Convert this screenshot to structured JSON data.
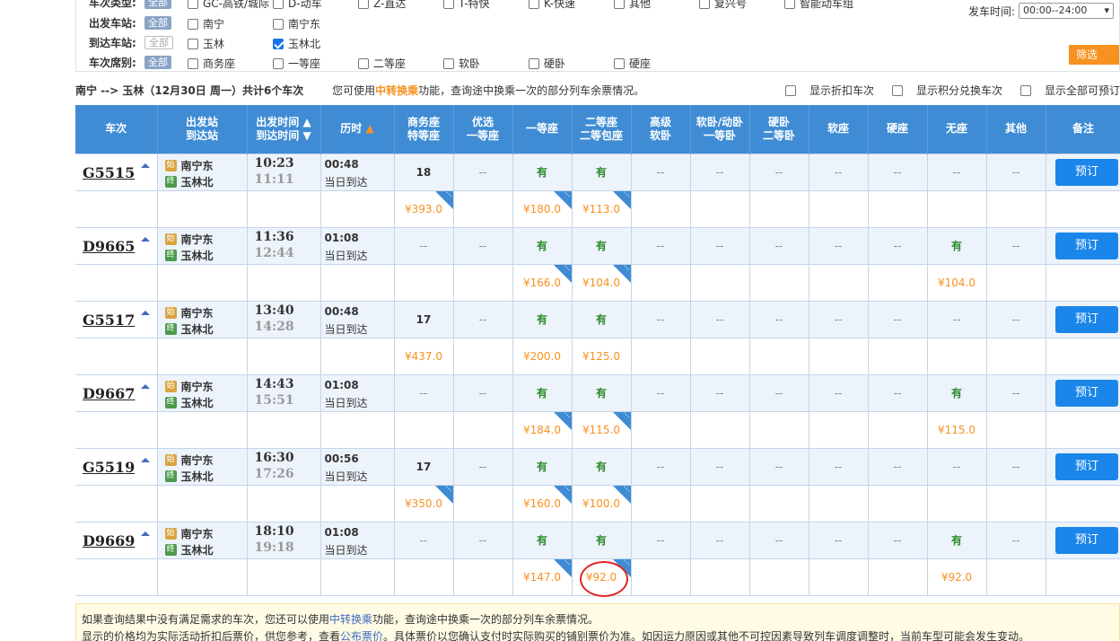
{
  "filters": {
    "type_row": {
      "label": "车次类型:",
      "all": "全部",
      "options": [
        "GC-高铁/城际",
        "D-动车",
        "Z-直达",
        "T-特快",
        "K-快速",
        "其他",
        "复兴号",
        "智能动车组"
      ]
    },
    "from_row": {
      "label": "出发车站:",
      "all": "全部",
      "options": [
        "南宁",
        "南宁东"
      ]
    },
    "to_row": {
      "label": "到达车站:",
      "all": "全部",
      "options": [
        "玉林",
        "玉林北"
      ]
    },
    "seat_row": {
      "label": "车次席别:",
      "all": "全部",
      "options": [
        "商务座",
        "一等座",
        "二等座",
        "软卧",
        "硬卧",
        "硬座"
      ]
    },
    "time_label": "发车时间:",
    "time_value": "00:00--24:00",
    "filter_button": "筛选"
  },
  "info": {
    "route": "南宁 --> 玉林（12月30日 周一）共计6个车次",
    "tip_prefix": "您可使用",
    "tip_link": "中转换乘",
    "tip_suffix": "功能，查询途中换乘一次的部分列车余票情况。",
    "check1": "显示折扣车次",
    "check2": "显示积分兑换车次",
    "check3": "显示全部可预订"
  },
  "headers": {
    "train": "车次",
    "station1": "出发站",
    "station2": "到达站",
    "time1": "出发时间",
    "time2": "到达时间",
    "duration": "历时",
    "business1": "商务座",
    "business2": "特等座",
    "premium1": "优选",
    "premium2": "一等座",
    "first": "一等座",
    "second1": "二等座",
    "second2": "二等包座",
    "hsoft1": "高级",
    "hsoft2": "软卧",
    "soft1": "软卧/动卧",
    "soft2": "一等卧",
    "hard1": "硬卧",
    "hard2": "二等卧",
    "softseat": "软座",
    "hardseat": "硬座",
    "noseat": "无座",
    "other": "其他",
    "remark": "备注"
  },
  "icons": {
    "start": "始",
    "end": "终"
  },
  "book_label": "预订",
  "trains": [
    {
      "no": "G5515",
      "from": "南宁东",
      "to": "玉林北",
      "dep": "10:23",
      "arr": "11:11",
      "dur": "00:48",
      "arrive": "当日到达",
      "business": "18",
      "premium": "--",
      "first": "有",
      "second": "有",
      "hsoft": "--",
      "soft": "--",
      "hard": "--",
      "softseat": "--",
      "hardseat": "--",
      "noseat": "--",
      "other": "--",
      "p_business": "¥393.0",
      "p_first": "¥180.0",
      "p_second": "¥113.0",
      "p_noseat": ""
    },
    {
      "no": "D9665",
      "from": "南宁东",
      "to": "玉林北",
      "dep": "11:36",
      "arr": "12:44",
      "dur": "01:08",
      "arrive": "当日到达",
      "business": "--",
      "premium": "--",
      "first": "有",
      "second": "有",
      "hsoft": "--",
      "soft": "--",
      "hard": "--",
      "softseat": "--",
      "hardseat": "--",
      "noseat": "有",
      "other": "--",
      "p_business": "",
      "p_first": "¥166.0",
      "p_second": "¥104.0",
      "p_noseat": "¥104.0"
    },
    {
      "no": "G5517",
      "from": "南宁东",
      "to": "玉林北",
      "dep": "13:40",
      "arr": "14:28",
      "dur": "00:48",
      "arrive": "当日到达",
      "business": "17",
      "premium": "--",
      "first": "有",
      "second": "有",
      "hsoft": "--",
      "soft": "--",
      "hard": "--",
      "softseat": "--",
      "hardseat": "--",
      "noseat": "--",
      "other": "--",
      "p_business": "¥437.0",
      "p_first": "¥200.0",
      "p_second": "¥125.0",
      "p_noseat": ""
    },
    {
      "no": "D9667",
      "from": "南宁东",
      "to": "玉林北",
      "dep": "14:43",
      "arr": "15:51",
      "dur": "01:08",
      "arrive": "当日到达",
      "business": "--",
      "premium": "--",
      "first": "有",
      "second": "有",
      "hsoft": "--",
      "soft": "--",
      "hard": "--",
      "softseat": "--",
      "hardseat": "--",
      "noseat": "有",
      "other": "--",
      "p_business": "",
      "p_first": "¥184.0",
      "p_second": "¥115.0",
      "p_noseat": "¥115.0"
    },
    {
      "no": "G5519",
      "from": "南宁东",
      "to": "玉林北",
      "dep": "16:30",
      "arr": "17:26",
      "dur": "00:56",
      "arrive": "当日到达",
      "business": "17",
      "premium": "--",
      "first": "有",
      "second": "有",
      "hsoft": "--",
      "soft": "--",
      "hard": "--",
      "softseat": "--",
      "hardseat": "--",
      "noseat": "--",
      "other": "--",
      "p_business": "¥350.0",
      "p_first": "¥160.0",
      "p_second": "¥100.0",
      "p_noseat": ""
    },
    {
      "no": "D9669",
      "from": "南宁东",
      "to": "玉林北",
      "dep": "18:10",
      "arr": "19:18",
      "dur": "01:08",
      "arrive": "当日到达",
      "business": "--",
      "premium": "--",
      "first": "有",
      "second": "有",
      "hsoft": "--",
      "soft": "--",
      "hard": "--",
      "softseat": "--",
      "hardseat": "--",
      "noseat": "有",
      "other": "--",
      "p_business": "",
      "p_first": "¥147.0",
      "p_second": "¥92.0",
      "p_noseat": "¥92.0"
    }
  ],
  "note": {
    "line1_prefix": "如果查询结果中没有满足需求的车次，您还可以使用",
    "line1_link": "中转换乘",
    "line1_suffix": "功能，查询途中换乘一次的部分列车余票情况。",
    "line2_prefix": "显示的价格均为实际活动折扣后票价，供您参考，查看",
    "line2_link": "公布票价",
    "line2_suffix": "。具体票价以您确认支付时实际购买的铺别票价为准。如因运力原因或其他不可控因素导致列车调度调整时，当前车型可能会发生变动。"
  }
}
